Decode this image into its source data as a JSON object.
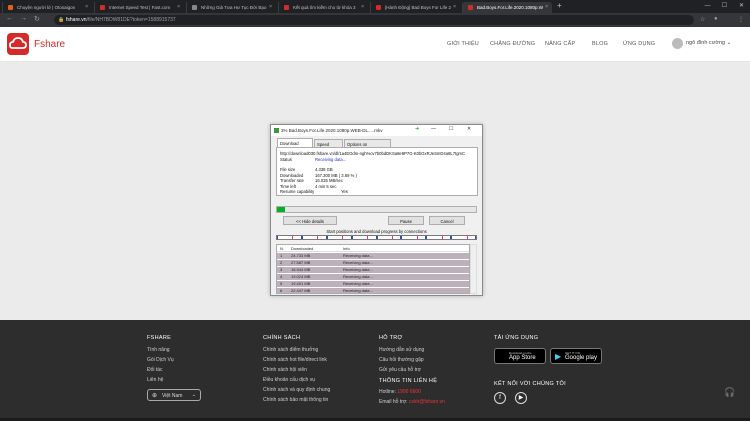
{
  "browser": {
    "tabs": [
      {
        "title": "Chuyện người lớ | Otosaigon",
        "color": "#e06020"
      },
      {
        "title": "Internet Speed Test | Fast.com",
        "color": "#d42a2a"
      },
      {
        "title": "Những Giả Tưa Hư Tục Đời Bạo",
        "color": "#888888"
      },
      {
        "title": "Kết quả tìm kiếm cho từ khóa 3",
        "color": "#d42a2a"
      },
      {
        "title": "[Hành Động] Bad Boys For Life 2",
        "color": "#d42a2a"
      },
      {
        "title": "Bad.Boys.For.Life.2020.1080p.W",
        "color": "#d42a2a"
      }
    ],
    "url_host": "fshare.vn",
    "url_path": "/file/NH7BDW81DE?token=1588915737"
  },
  "site": {
    "brand": "Fshare",
    "menu": [
      "GIỚI THIỆU",
      "CHẶNG ĐƯỜNG",
      "NÂNG CẤP",
      "BLOG",
      "ỨNG DỤNG"
    ],
    "user": "ngô đình cường"
  },
  "download": {
    "title": "3% Bad.Boys.For.Life.2020.1080p.WEB-DL.....mkv",
    "tabs": [
      "Download status",
      "Speed Limiter",
      "Options on completion"
    ],
    "url": "http://download030.fshare.vn/dl/1a4EOdm-ngh%cv7b0bdDKSa8e9P7G-K0bGxRJeSmD4a8L7tgmC",
    "status_label": "Status",
    "status": "Receiving data...",
    "rows": [
      {
        "label": "File size",
        "value": "4.338 GB",
        "blue": false
      },
      {
        "label": "Downloaded",
        "value": "167.300 MB ( 3.69 % )",
        "blue": false
      },
      {
        "label": "Transfer rate",
        "value": "16.035 MB/sec",
        "blue": false
      },
      {
        "label": "Time left",
        "value": "4 min 5 sec",
        "blue": false
      },
      {
        "label": "Resume capability",
        "value": "Yes",
        "blue": false
      }
    ],
    "progress": 0.0369,
    "hide_details": "<< Hide details",
    "pause": "Pause",
    "cancel": "Cancel",
    "connections_label": "Start positions and download progress by connections",
    "table_headers": [
      "N.",
      "Downloaded",
      "Info"
    ],
    "connections": [
      {
        "n": "1",
        "downloaded": "24.733 MB",
        "info": "Receiving data..."
      },
      {
        "n": "2",
        "downloaded": "27.587 MB",
        "info": "Receiving data..."
      },
      {
        "n": "3",
        "downloaded": "18.944 MB",
        "info": "Receiving data..."
      },
      {
        "n": "4",
        "downloaded": "19.024 MB",
        "info": "Receiving data..."
      },
      {
        "n": "5",
        "downloaded": "19.401 MB",
        "info": "Receiving data..."
      },
      {
        "n": "6",
        "downloaded": "22.447 MB",
        "info": "Receiving data..."
      }
    ]
  },
  "footer": {
    "col1": {
      "heading": "FSHARE",
      "links": [
        "Tính năng",
        "Gói Dịch Vụ",
        "Đối tác",
        "Liên hệ"
      ],
      "language": "Việt Nam"
    },
    "col2": {
      "heading": "CHÍNH SÁCH",
      "links": [
        "Chính sách điểm thưởng",
        "Chính sách hot file/direct link",
        "Chính sách hội viên",
        "Điều khoản cấu dịch vụ",
        "Chính sách và quy định chung",
        "Chính sách bảo mật thông tin"
      ]
    },
    "col3": {
      "heading": "HỖ TRỢ",
      "links": [
        "Hướng dẫn sử dụng",
        "Câu hỏi thường gặp",
        "Gửi yêu cầu hỗ trợ"
      ],
      "contact_heading": "THÔNG TIN LIÊN HỆ",
      "hotline_label": "Hotline:",
      "hotline": "1900 6600",
      "email_label": "Email hỗ trợ:",
      "email": "cskh@fshare.vn"
    },
    "col4": {
      "heading": "TẢI ỨNG DỤNG",
      "appstore_small": "Download on the",
      "appstore": "App Store",
      "gplay_small": "GET IT ON",
      "gplay": "Google play",
      "social_heading": "KẾT NỐI VỚI CHÚNG TÔI"
    }
  },
  "colors": {
    "brand": "#d42a2a",
    "progress": "#06b025",
    "footer": "#2d2d2d"
  }
}
